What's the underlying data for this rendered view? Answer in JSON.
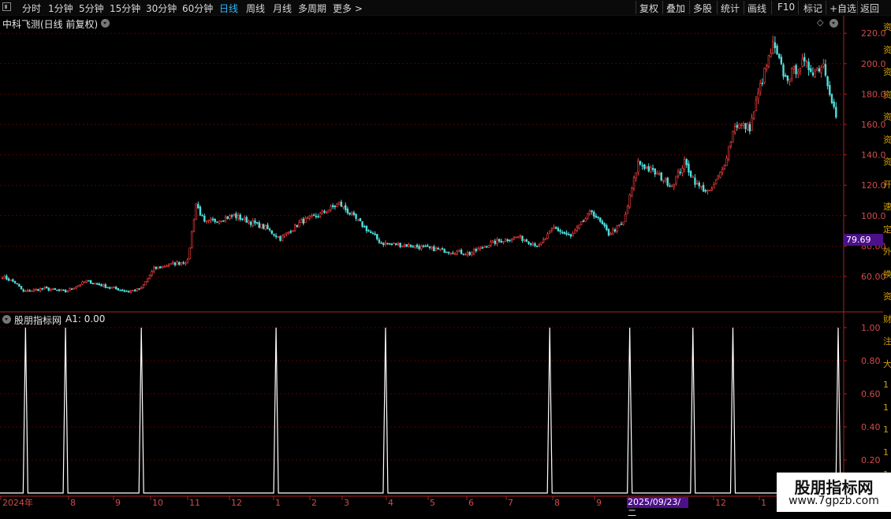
{
  "toolbar": {
    "periods": [
      "分时",
      "1分钟",
      "5分钟",
      "15分钟",
      "30分钟",
      "60分钟",
      "日线",
      "周线",
      "月线",
      "多周期",
      "更多 >"
    ],
    "active_period": "日线",
    "actions": [
      "复权",
      "叠加",
      "多股",
      "统计",
      "画线",
      "F10",
      "标记",
      "+自选",
      "返回"
    ]
  },
  "main_chart": {
    "title": "中科飞测(日线 前复权)",
    "y_ticks": [
      "220.0",
      "200.0",
      "180.0",
      "160.0",
      "140.0",
      "120.0",
      "100.0",
      "80.00",
      "60.00"
    ],
    "current_price": "79.69"
  },
  "indicator": {
    "title": "股朋指标网",
    "value_label": "A1: 0.00",
    "y_ticks": [
      "1.00",
      "0.80",
      "0.60",
      "0.40",
      "0.20"
    ]
  },
  "x_axis": {
    "labels": [
      "2024年",
      "8",
      "9",
      "10",
      "11",
      "12",
      "1",
      "2",
      "3",
      "4",
      "5",
      "6",
      "7",
      "8",
      "9",
      "2025/09/23/二",
      "12",
      "1"
    ],
    "highlighted_date": "2025/09/23/二"
  },
  "right_strip_chars": [
    "资",
    "资",
    "资",
    "资",
    "资",
    "资",
    "资",
    "开",
    "速",
    "定",
    "外",
    "换",
    "资",
    "财",
    "注",
    "大",
    "1",
    "1",
    "1",
    "1",
    "1"
  ],
  "watermark": {
    "title": "股朋指标网",
    "url": "www.7gpzb.com"
  },
  "colors": {
    "up": "#ff4040",
    "down": "#50e0e0",
    "grid": "#5a0000",
    "axis": "#b02020",
    "signal": "#ffffff",
    "highlight": "#4c108a"
  },
  "chart_data": {
    "type": "candlestick",
    "title": "中科飞测(日线 前复权)",
    "ylim": [
      40,
      225
    ],
    "y_ticks": [
      60,
      80,
      100,
      120,
      140,
      160,
      180,
      200,
      220
    ],
    "last_price": 79.69,
    "anchors": [
      {
        "t": 0,
        "p": 60
      },
      {
        "t": 6,
        "p": 56
      },
      {
        "t": 10,
        "p": 50
      },
      {
        "t": 20,
        "p": 52
      },
      {
        "t": 30,
        "p": 50
      },
      {
        "t": 40,
        "p": 57
      },
      {
        "t": 50,
        "p": 53
      },
      {
        "t": 60,
        "p": 50
      },
      {
        "t": 66,
        "p": 52
      },
      {
        "t": 72,
        "p": 65
      },
      {
        "t": 80,
        "p": 68
      },
      {
        "t": 88,
        "p": 70
      },
      {
        "t": 92,
        "p": 108
      },
      {
        "t": 96,
        "p": 95
      },
      {
        "t": 110,
        "p": 100
      },
      {
        "t": 125,
        "p": 92
      },
      {
        "t": 132,
        "p": 85
      },
      {
        "t": 142,
        "p": 96
      },
      {
        "t": 150,
        "p": 100
      },
      {
        "t": 160,
        "p": 108
      },
      {
        "t": 170,
        "p": 95
      },
      {
        "t": 180,
        "p": 82
      },
      {
        "t": 195,
        "p": 80
      },
      {
        "t": 210,
        "p": 77
      },
      {
        "t": 222,
        "p": 75
      },
      {
        "t": 232,
        "p": 82
      },
      {
        "t": 245,
        "p": 86
      },
      {
        "t": 255,
        "p": 80
      },
      {
        "t": 262,
        "p": 92
      },
      {
        "t": 270,
        "p": 86
      },
      {
        "t": 280,
        "p": 103
      },
      {
        "t": 288,
        "p": 88
      },
      {
        "t": 295,
        "p": 95
      },
      {
        "t": 302,
        "p": 135
      },
      {
        "t": 310,
        "p": 128
      },
      {
        "t": 318,
        "p": 120
      },
      {
        "t": 324,
        "p": 135
      },
      {
        "t": 330,
        "p": 120
      },
      {
        "t": 336,
        "p": 115
      },
      {
        "t": 342,
        "p": 130
      },
      {
        "t": 348,
        "p": 160
      },
      {
        "t": 355,
        "p": 158
      },
      {
        "t": 360,
        "p": 185
      },
      {
        "t": 366,
        "p": 212
      },
      {
        "t": 372,
        "p": 190
      },
      {
        "t": 380,
        "p": 200
      },
      {
        "t": 386,
        "p": 195
      },
      {
        "t": 390,
        "p": 200
      },
      {
        "t": 396,
        "p": 165
      }
    ],
    "total_bars": 397,
    "indicator": {
      "name": "A1",
      "value": 0.0,
      "ylim": [
        0,
        1.1
      ],
      "y_ticks": [
        0.2,
        0.4,
        0.6,
        0.8,
        1.0
      ],
      "spike_bars": [
        11,
        30,
        66,
        130,
        182,
        260,
        298,
        328,
        347,
        397
      ]
    }
  }
}
